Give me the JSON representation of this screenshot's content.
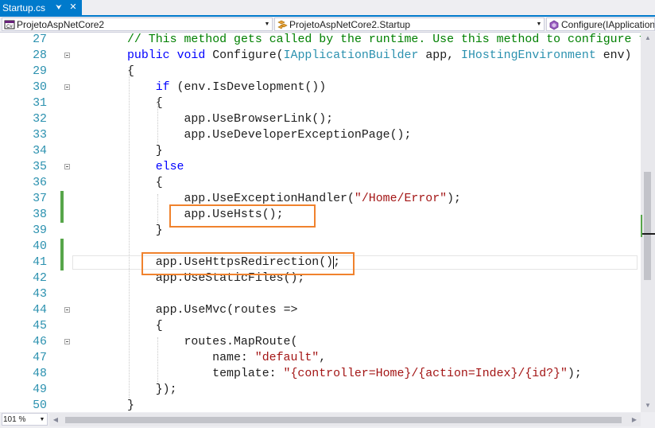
{
  "tab": {
    "title": "Startup.cs",
    "pin_icon": "pin-icon",
    "close_icon": "close-icon"
  },
  "navbar": {
    "project": "ProjetoAspNetCore2",
    "class_name": "ProjetoAspNetCore2.Startup",
    "member": "Configure(IApplicationBuilder"
  },
  "code_lines": [
    {
      "n": "27",
      "indent": 2,
      "tokens": [
        {
          "c": "cm",
          "t": "// This method gets called by the runtime. Use this method to configure the HTTP request pipeline."
        }
      ]
    },
    {
      "n": "28",
      "indent": 2,
      "fold": true,
      "tokens": [
        {
          "c": "kw",
          "t": "public"
        },
        {
          "c": "",
          "t": " "
        },
        {
          "c": "kw",
          "t": "void"
        },
        {
          "c": "",
          "t": " Configure("
        },
        {
          "c": "ty",
          "t": "IApplicationBuilder"
        },
        {
          "c": "",
          "t": " app, "
        },
        {
          "c": "ty",
          "t": "IHostingEnvironment"
        },
        {
          "c": "",
          "t": " env)"
        }
      ]
    },
    {
      "n": "29",
      "indent": 2,
      "tokens": [
        {
          "c": "",
          "t": "{"
        }
      ]
    },
    {
      "n": "30",
      "indent": 3,
      "fold": true,
      "tokens": [
        {
          "c": "kw",
          "t": "if"
        },
        {
          "c": "",
          "t": " (env.IsDevelopment())"
        }
      ]
    },
    {
      "n": "31",
      "indent": 3,
      "tokens": [
        {
          "c": "",
          "t": "{"
        }
      ]
    },
    {
      "n": "32",
      "indent": 4,
      "tokens": [
        {
          "c": "",
          "t": "app.UseBrowserLink();"
        }
      ]
    },
    {
      "n": "33",
      "indent": 4,
      "tokens": [
        {
          "c": "",
          "t": "app.UseDeveloperExceptionPage();"
        }
      ]
    },
    {
      "n": "34",
      "indent": 3,
      "tokens": [
        {
          "c": "",
          "t": "}"
        }
      ]
    },
    {
      "n": "35",
      "indent": 3,
      "fold": true,
      "tokens": [
        {
          "c": "kw",
          "t": "else"
        }
      ]
    },
    {
      "n": "36",
      "indent": 3,
      "tokens": [
        {
          "c": "",
          "t": "{"
        }
      ]
    },
    {
      "n": "37",
      "indent": 4,
      "changed": true,
      "tokens": [
        {
          "c": "",
          "t": "app.UseExceptionHandler("
        },
        {
          "c": "st",
          "t": "\"/Home/Error\""
        },
        {
          "c": "",
          "t": ");"
        }
      ]
    },
    {
      "n": "38",
      "indent": 4,
      "changed": true,
      "tokens": [
        {
          "c": "",
          "t": "app.UseHsts();"
        }
      ]
    },
    {
      "n": "39",
      "indent": 3,
      "tokens": [
        {
          "c": "",
          "t": "}"
        }
      ]
    },
    {
      "n": "40",
      "indent": 3,
      "changed": true,
      "tokens": []
    },
    {
      "n": "41",
      "indent": 3,
      "changed": true,
      "current": true,
      "tokens": [
        {
          "c": "",
          "t": "app.UseHttpsRedirection();"
        }
      ]
    },
    {
      "n": "42",
      "indent": 3,
      "tokens": [
        {
          "c": "",
          "t": "app.UseStaticFiles();"
        }
      ]
    },
    {
      "n": "43",
      "indent": 3,
      "tokens": []
    },
    {
      "n": "44",
      "indent": 3,
      "fold": true,
      "tokens": [
        {
          "c": "",
          "t": "app.UseMvc(routes =>"
        }
      ]
    },
    {
      "n": "45",
      "indent": 3,
      "tokens": [
        {
          "c": "",
          "t": "{"
        }
      ]
    },
    {
      "n": "46",
      "indent": 4,
      "fold": true,
      "tokens": [
        {
          "c": "",
          "t": "routes.MapRoute("
        }
      ]
    },
    {
      "n": "47",
      "indent": 5,
      "tokens": [
        {
          "c": "",
          "t": "name: "
        },
        {
          "c": "st",
          "t": "\"default\""
        },
        {
          "c": "",
          "t": ","
        }
      ]
    },
    {
      "n": "48",
      "indent": 5,
      "tokens": [
        {
          "c": "",
          "t": "template: "
        },
        {
          "c": "st",
          "t": "\"{controller=Home}/{action=Index}/{id?}\""
        },
        {
          "c": "",
          "t": ");"
        }
      ]
    },
    {
      "n": "49",
      "indent": 3,
      "tokens": [
        {
          "c": "",
          "t": "});"
        }
      ]
    },
    {
      "n": "50",
      "indent": 2,
      "tokens": [
        {
          "c": "",
          "t": "}"
        }
      ]
    }
  ],
  "highlights": [
    {
      "line": "38",
      "label": "app.UseHsts();"
    },
    {
      "line": "41",
      "label": "app.UseHttpsRedirection();"
    }
  ],
  "colors": {
    "accent": "#007acc",
    "keyword": "#0000ff",
    "type": "#2b91af",
    "comment": "#008000",
    "string": "#a31515",
    "changed_bar": "#57a64a",
    "highlight_box": "#f0822d"
  },
  "zoom": "101 %"
}
